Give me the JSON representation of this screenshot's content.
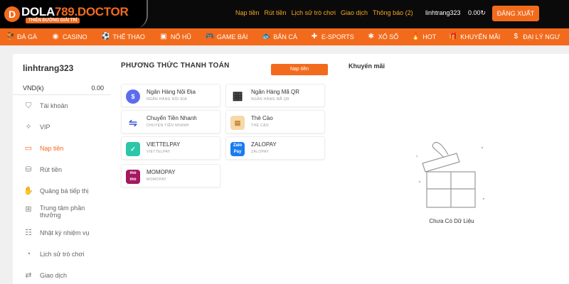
{
  "header": {
    "logo_main": "DOLA",
    "logo_num": "789",
    "logo_domain": ".DOCTOR",
    "logo_tagline": "THIÊN ĐƯỜNG GIẢI TRÍ",
    "links": [
      "Nạp tiền",
      "Rút tiền",
      "Lịch sử trò chơi",
      "Giao dịch",
      "Thông báo (2)"
    ],
    "username": "linhtrang323",
    "balance": "0.00",
    "logout_label": "ĐĂNG XUẤT",
    "accent": "#f26b1d"
  },
  "nav": [
    {
      "label": "ĐÁ GÀ",
      "icon": "rooster-icon"
    },
    {
      "label": "CASINO",
      "icon": "casino-chip-icon"
    },
    {
      "label": "THỂ THAO",
      "icon": "soccer-ball-icon"
    },
    {
      "label": "NỔ HŨ",
      "icon": "slot-machine-icon"
    },
    {
      "label": "GAME BÀI",
      "icon": "gamepad-icon"
    },
    {
      "label": "BẮN CÁ",
      "icon": "fish-icon"
    },
    {
      "label": "E-SPORTS",
      "icon": "controller-icon"
    },
    {
      "label": "XỔ SỐ",
      "icon": "lottery-icon"
    },
    {
      "label": "HOT",
      "icon": "fire-icon"
    },
    {
      "label": "KHUYẾN MÃI",
      "icon": "gift-icon"
    },
    {
      "label": "ĐẠI LÝ NGƯ",
      "icon": "agent-icon"
    }
  ],
  "sidebar": {
    "username": "linhtrang323",
    "currency": "VND(k)",
    "amount": "0.00",
    "items": [
      {
        "label": "Tài khoản",
        "icon": "account-shield-icon"
      },
      {
        "label": "VIP",
        "icon": "vip-star-icon"
      },
      {
        "label": "Nạp tiền",
        "icon": "deposit-card-icon",
        "active": true
      },
      {
        "label": "Rút tiền",
        "icon": "withdraw-coins-icon"
      },
      {
        "label": "Quảng bá tiếp thị",
        "icon": "megaphone-icon"
      },
      {
        "label": "Trung tâm phần thưởng",
        "icon": "reward-gift-icon"
      },
      {
        "label": "Nhật ký nhiệm vụ",
        "icon": "task-list-icon"
      },
      {
        "label": "Lịch sử trò chơi",
        "icon": "game-history-icon"
      },
      {
        "label": "Giao dịch",
        "icon": "transaction-icon"
      }
    ]
  },
  "payment": {
    "title": "PHƯƠNG THỨC THANH TOÁN",
    "tab_label": "Nạp tiền",
    "methods": [
      {
        "name": "Ngân Hàng Nội Địa",
        "sub": "NGÂN HÀNG NỘI ĐỊA",
        "icon": "bank-coin-icon",
        "color": "#5b6cf0"
      },
      {
        "name": "Ngân Hàng Mã QR",
        "sub": "NGÂN HÀNG MÃ QR",
        "icon": "qr-code-icon",
        "color": "#333333"
      },
      {
        "name": "Chuyển Tiền Nhanh",
        "sub": "CHUYỂN TIỀN NHANH",
        "icon": "fast-transfer-icon",
        "color": "#3a5bd9"
      },
      {
        "name": "Thẻ Cào",
        "sub": "THẺ CÀO",
        "icon": "scratch-card-icon",
        "color": "#e8a24a"
      },
      {
        "name": "VIETTELPAY",
        "sub": "VIETTELPAY",
        "icon": "viettelpay-icon",
        "color": "#2cc7a8"
      },
      {
        "name": "ZALOPAY",
        "sub": "ZALOPAY",
        "icon": "zalopay-icon",
        "color": "#1a7cf0"
      },
      {
        "name": "MOMOPAY",
        "sub": "MOMOPAY",
        "icon": "momo-icon",
        "color": "#a5185f"
      }
    ]
  },
  "promo": {
    "title": "Khuyến mãi",
    "empty_text": "Chưa Có Dữ Liệu"
  }
}
